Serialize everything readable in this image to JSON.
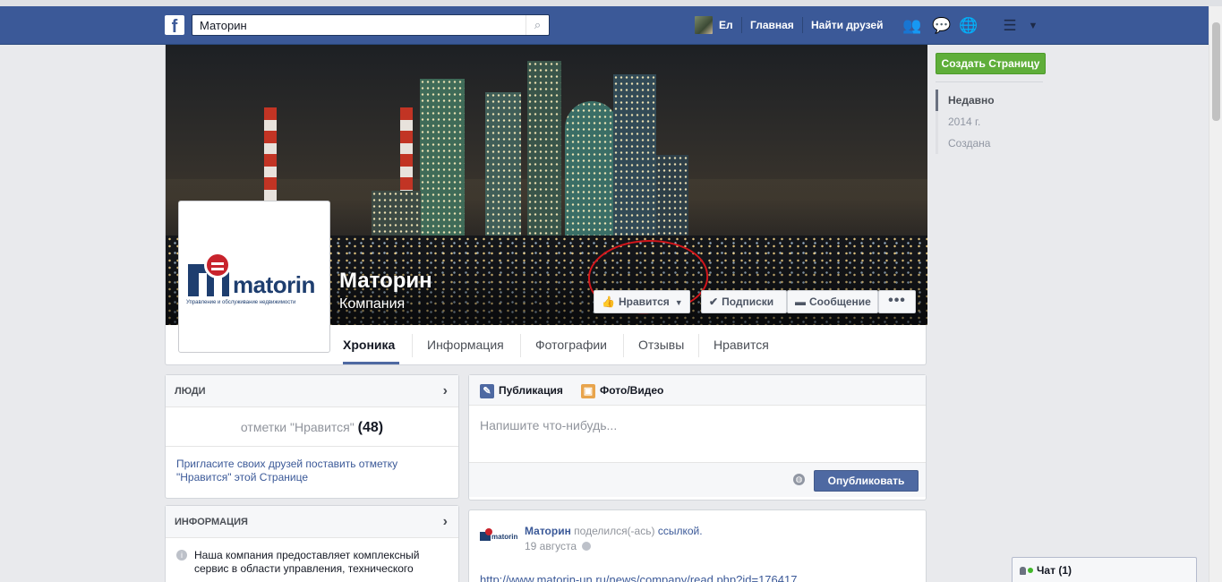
{
  "topbar": {
    "logo": "f",
    "search": {
      "value": "Маторин",
      "icon": "search-icon"
    },
    "user_name": "Ел",
    "nav_home": "Главная",
    "nav_find_friends": "Найти друзей",
    "icons": [
      "friend-requests-icon",
      "messages-icon",
      "notifications-icon",
      "privacy-icon",
      "settings-arrow-icon"
    ]
  },
  "cover": {
    "page_name": "Маторин",
    "category": "Компания",
    "logo_word": "matorin",
    "logo_tagline": "Управление и обслуживание недвижимости",
    "buttons": {
      "like": "Нравится",
      "subscriptions": "Подписки",
      "message": "Сообщение",
      "more": "•••"
    }
  },
  "tabs": [
    "Хроника",
    "Информация",
    "Фотографии",
    "Отзывы",
    "Нравится"
  ],
  "right_column": {
    "create_page": "Создать Страницу",
    "timeline_nav": [
      "Недавно",
      "2014 г.",
      "Создана"
    ]
  },
  "people_card": {
    "title": "ЛЮДИ",
    "likes_label": "отметки \"Нравится\"",
    "likes_count": "(48)",
    "invite_text": "Пригласите своих друзей поставить отметку \"Нравится\" этой Странице"
  },
  "info_card": {
    "title": "ИНФОРМАЦИЯ",
    "text": "Наша компания предоставляет комплексный сервис в области управления, технического"
  },
  "composer": {
    "tab_post": "Публикация",
    "tab_photo": "Фото/Видео",
    "placeholder": "Напишите что-нибудь...",
    "publish": "Опубликовать"
  },
  "post": {
    "author": "Маторин",
    "action_prefix": "поделился(-ась)",
    "action_link": "ссылкой.",
    "date": "19 августа",
    "link": "http://www.matorin-un.ru/news/company/read.php?id=176417"
  },
  "chat": {
    "label": "Чат (1)"
  },
  "colors": {
    "facebook_blue": "#3b5998",
    "create_green": "#5fae3a",
    "highlight_red": "#d3161b"
  }
}
